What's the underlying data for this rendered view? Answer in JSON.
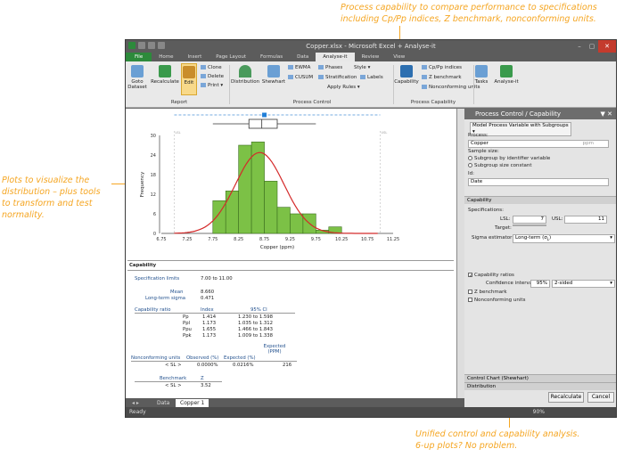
{
  "callouts": {
    "top": [
      "Process capability to compare performance to specifications",
      "including Cp/Pp indices, Z benchmark, nonconforming units."
    ],
    "left": [
      "Plots to visualize the",
      "distribution – plus tools",
      "to transform and test",
      "normality."
    ],
    "bottom": [
      "Unified control and capability analysis.",
      "6-up plots? No problem."
    ]
  },
  "window": {
    "title": "Copper.xlsx - Microsoft Excel + Analyse-it",
    "tabs": [
      "File",
      "Home",
      "Insert",
      "Page Layout",
      "Formulas",
      "Data",
      "Analyse-it",
      "Review",
      "View"
    ],
    "active_tab": "Analyse-it",
    "accent": "#2d8a3b"
  },
  "ribbon": {
    "goto_dataset": "Goto Dataset",
    "recalculate": "Recalculate",
    "edit": "Edit",
    "clone": "Clone",
    "delete": "Delete",
    "print": "Print",
    "report_group": "Report",
    "distribution": "Distribution",
    "shewhart": "Shewhart",
    "ewma": "EWMA",
    "cusum": "CUSUM",
    "phases": "Phases",
    "stratification": "Stratification",
    "style": "Style",
    "labels": "Labels",
    "apply_rules": "Apply Rules",
    "process_control_group": "Process Control",
    "capability": "Capability",
    "cp_pp": "Cp/Pp indices",
    "z_benchmark": "Z benchmark",
    "nonconforming": "Nonconforming units",
    "process_capability_group": "Process Capability",
    "tasks": "Tasks",
    "analyse_it": "Analyse-it"
  },
  "chart_data": {
    "type": "bar",
    "xlabel": "Copper (ppm)",
    "ylabel": "Frequency",
    "x_ticks": [
      "6.75",
      "7.25",
      "7.75",
      "8.25",
      "8.75",
      "9.25",
      "9.75",
      "10.25",
      "10.75",
      "11.25"
    ],
    "y_ticks": [
      "0",
      "6",
      "12",
      "18",
      "24",
      "30"
    ],
    "ylim": [
      0,
      30
    ],
    "xlim": [
      6.75,
      11.25
    ],
    "bin_width": 0.25,
    "bins_start": [
      7.75,
      8.0,
      8.25,
      8.5,
      8.75,
      9.0,
      9.25,
      9.5,
      9.75,
      10.0
    ],
    "values": [
      10,
      13,
      27,
      28,
      16,
      8,
      6,
      6,
      1,
      2
    ],
    "curve_color": "#d42a2a",
    "bar_color": "#7cc146",
    "spec_limits": [
      "LSL",
      "USL"
    ]
  },
  "report": {
    "capability_title": "Capability",
    "spec_limits_label": "Specification limits",
    "spec_limits_value": "7.00 to 11.00",
    "mean_label": "Mean",
    "mean_value": "8.660",
    "sigma_label": "Long-term sigma",
    "sigma_value": "0.471",
    "ratio_header": "Capability ratio",
    "index_header": "Index",
    "ci_header": "95% CI",
    "ratios": [
      {
        "name": "Pp",
        "index": "1.414",
        "ci": "1.230 to 1.598"
      },
      {
        "name": "Ppl",
        "index": "1.173",
        "ci": "1.035 to 1.312"
      },
      {
        "name": "Ppu",
        "index": "1.655",
        "ci": "1.466 to 1.843"
      },
      {
        "name": "Ppk",
        "index": "1.173",
        "ci": "1.009 to 1.338"
      }
    ],
    "nc_header": "Nonconforming units",
    "obs_header": "Observed (%)",
    "exp_header": "Expected (%)",
    "ppm_header": "Expected (PPM)",
    "nc_row": {
      "name": "< SL >",
      "observed": "0.0000%",
      "expected": "0.0216%",
      "ppm": "216"
    },
    "bench_header": "Benchmark",
    "z_header": "Z",
    "bench_row": {
      "name": "< SL >",
      "z": "3.52"
    }
  },
  "panel": {
    "title": "Process Control / Capability",
    "model": "Model Process Variable with Subgroups",
    "process_label": "Process:",
    "process_value": "Copper",
    "process_units": "ppm",
    "sample_size_label": "Sample size:",
    "subgroup_identifier": "Subgroup by identifier variable",
    "subgroup_constant": "Subgroup size constant",
    "id_label": "Id:",
    "id_value": "Date",
    "capability_section": "Capability",
    "specifications_label": "Specifications:",
    "lsl_label": "LSL:",
    "lsl_value": "7",
    "usl_label": "USL:",
    "usl_value": "11",
    "target_label": "Target:",
    "sigma_label": "Sigma estimator:",
    "sigma_value": "Long-term (σ",
    "sigma_sub": "L",
    "capability_ratios": "Capability ratios",
    "ci_label": "Confidence interval:",
    "ci_value": "95%",
    "ci_sided": "2-sided",
    "z_benchmark": "Z benchmark",
    "nonconforming": "Nonconforming units",
    "control_chart": "Control Chart (Shewhart)",
    "distribution": "Distribution",
    "recalculate": "Recalculate",
    "cancel": "Cancel"
  },
  "sheets": {
    "data": "Data",
    "copper": "Copper 1"
  },
  "status": {
    "ready": "Ready",
    "zoom": "90%"
  }
}
